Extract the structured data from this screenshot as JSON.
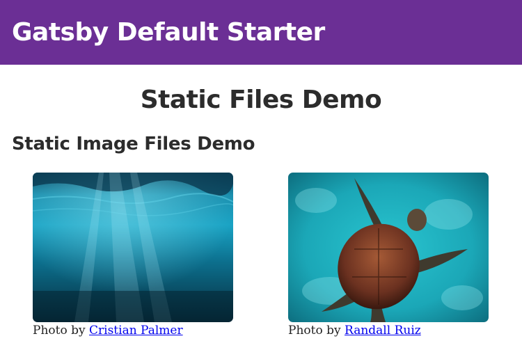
{
  "header": {
    "site_title": "Gatsby Default Starter"
  },
  "main": {
    "page_title": "Static Files Demo",
    "section_title": "Static Image Files Demo",
    "photos": [
      {
        "subject": "underwater-ocean-photo",
        "caption_prefix": "Photo by",
        "credit_link": "Cristian Palmer"
      },
      {
        "subject": "sea-turtle-photo",
        "caption_prefix": "Photo by",
        "credit_link": "Randall Ruiz"
      }
    ]
  },
  "colors": {
    "header_bg": "#6b2f95",
    "link": "#0000ee"
  }
}
